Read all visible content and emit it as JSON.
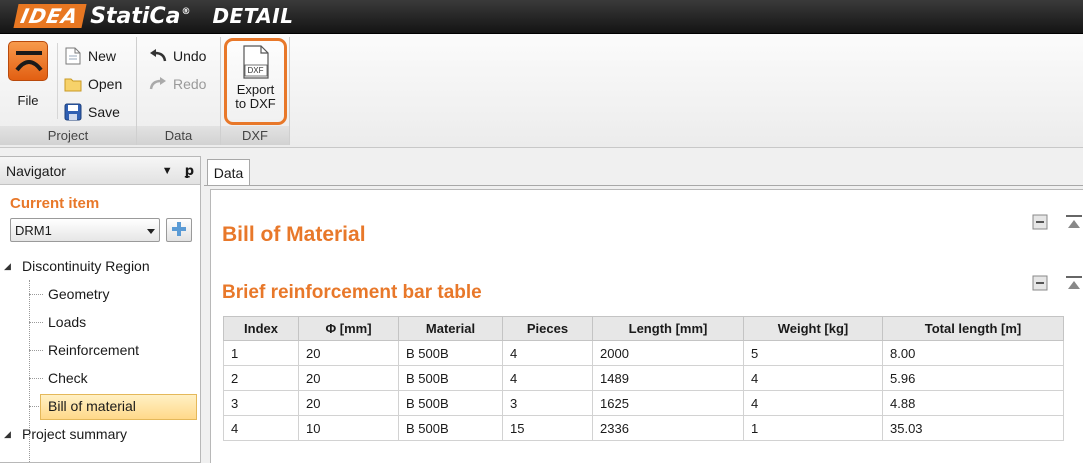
{
  "app": {
    "logo_idea": "IDEA",
    "logo_statica": "StatiCa",
    "logo_reg": "®",
    "logo_detail": "DETAIL"
  },
  "ribbon": {
    "file_label": "File",
    "new_label": "New",
    "open_label": "Open",
    "save_label": "Save",
    "undo_label": "Undo",
    "redo_label": "Redo",
    "dxf_icon_text": "DXF",
    "export_line1": "Export",
    "export_line2": "to DXF",
    "group_project": "Project",
    "group_data": "Data",
    "group_dxf": "DXF"
  },
  "navigator": {
    "title": "Navigator",
    "dropdown_glyph": "▼",
    "pin_glyph": "ꝑ",
    "current_item_label": "Current item",
    "current_item_value": "DRM1",
    "tree": {
      "root1": "Discontinuity Region",
      "children": [
        "Geometry",
        "Loads",
        "Reinforcement",
        "Check",
        "Bill of material"
      ],
      "root2": "Project summary"
    }
  },
  "main": {
    "tab_label": "Data",
    "heading": "Bill of Material",
    "subheading": "Brief reinforcement bar table",
    "table": {
      "columns": [
        "Index",
        "Φ [mm]",
        "Material",
        "Pieces",
        "Length [mm]",
        "Weight [kg]",
        "Total length [m]"
      ],
      "rows": [
        [
          "1",
          "20",
          "B 500B",
          "4",
          "2000",
          "5",
          "8.00"
        ],
        [
          "2",
          "20",
          "B 500B",
          "4",
          "1489",
          "4",
          "5.96"
        ],
        [
          "3",
          "20",
          "B 500B",
          "3",
          "1625",
          "4",
          "4.88"
        ],
        [
          "4",
          "10",
          "B 500B",
          "15",
          "2336",
          "1",
          "35.03"
        ]
      ]
    }
  },
  "colors": {
    "accent": "#e8782a",
    "selection": "#ffd98a",
    "titlebar": "#1a1a1a"
  }
}
